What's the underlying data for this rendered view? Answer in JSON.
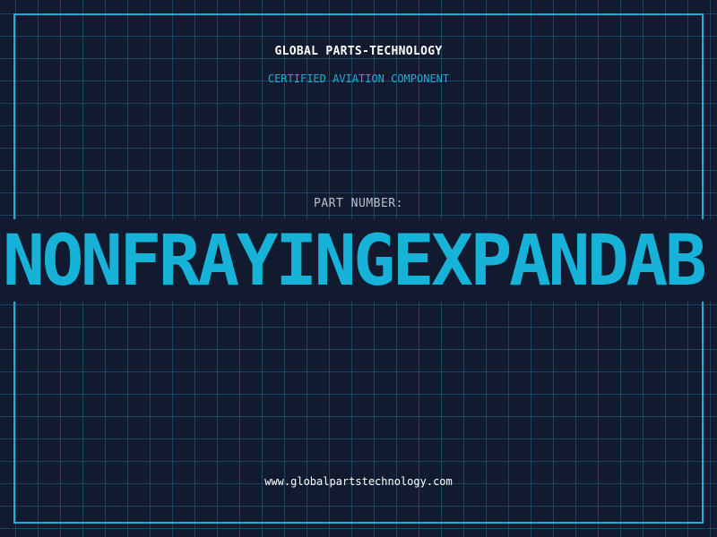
{
  "header": {
    "company": "GLOBAL PARTS-TECHNOLOGY",
    "subtitle": "CERTIFIED AVIATION COMPONENT"
  },
  "part": {
    "label": "PART NUMBER:",
    "number": "NONFRAYINGEXPANDAB"
  },
  "footer": {
    "website": "www.globalpartstechnology.com"
  },
  "colors": {
    "background": "#111a2f",
    "accent": "#1eaed3",
    "grid": "#1f5a78",
    "text": "#ffffff"
  }
}
